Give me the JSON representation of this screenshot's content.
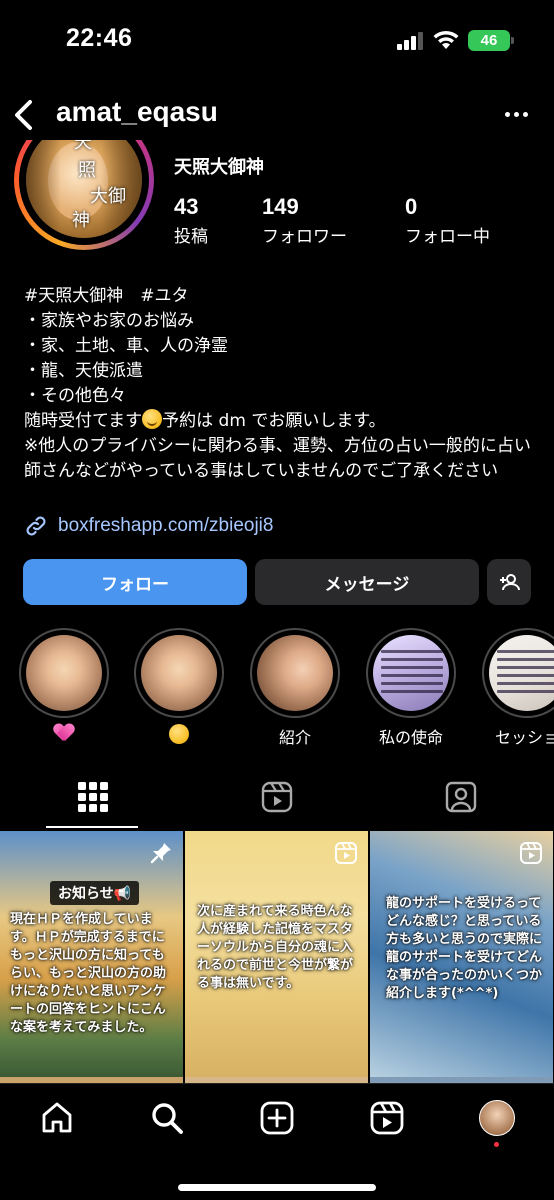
{
  "status_bar": {
    "time": "22:46",
    "battery": "46"
  },
  "header": {
    "username": "amat_eqasu"
  },
  "profile": {
    "display_name": "天照大御神",
    "avatar_kanji": [
      "天",
      "照",
      "大御",
      "神"
    ],
    "stats": [
      {
        "number": "43",
        "label": "投稿"
      },
      {
        "number": "149",
        "label": "フォロワー"
      },
      {
        "number": "0",
        "label": "フォロー中"
      }
    ],
    "bio": {
      "line1": "#天照大御神　#ユタ",
      "line2": "・家族やお家のお悩み",
      "line3": "・家、土地、車、人の浄霊",
      "line4": "・龍、天使派遣",
      "line5": "・その他色々",
      "line6_a": "随時受付てます",
      "line6_b": "予約は dm でお願いします。",
      "line7": "※他人のプライバシーに関わる事、運勢、方位の占い一般的に占い師さんなどがやっている事はしていませんのでご了承ください"
    },
    "link": "boxfreshapp.com/zbieoji8"
  },
  "buttons": {
    "follow": "フォロー",
    "message": "メッセージ"
  },
  "highlights": [
    {
      "label": ""
    },
    {
      "label": ""
    },
    {
      "label": "紹介"
    },
    {
      "label": "私の使命"
    },
    {
      "label": "セッショ"
    }
  ],
  "posts": [
    {
      "badge": "お知らせ📢",
      "text": "現在ＨＰを作成しています。ＨＰが完成するまでにもっと沢山の方に知ってもらい、もっと沢山の方の助けになりたいと思いアンケートの回答をヒントにこんな案を考えてみました。"
    },
    {
      "text": "次に産まれて来る時色んな人が経験した記憶をマスターソウルから自分の魂に入れるので前世と今世が繋がる事は無いです。"
    },
    {
      "text": "龍のサポートを受けるってどんな感じ？と思っている方も多いと思うので実際に龍のサポートを受けてどんな事が合ったのかいくつか紹介します(*^^*)"
    }
  ]
}
